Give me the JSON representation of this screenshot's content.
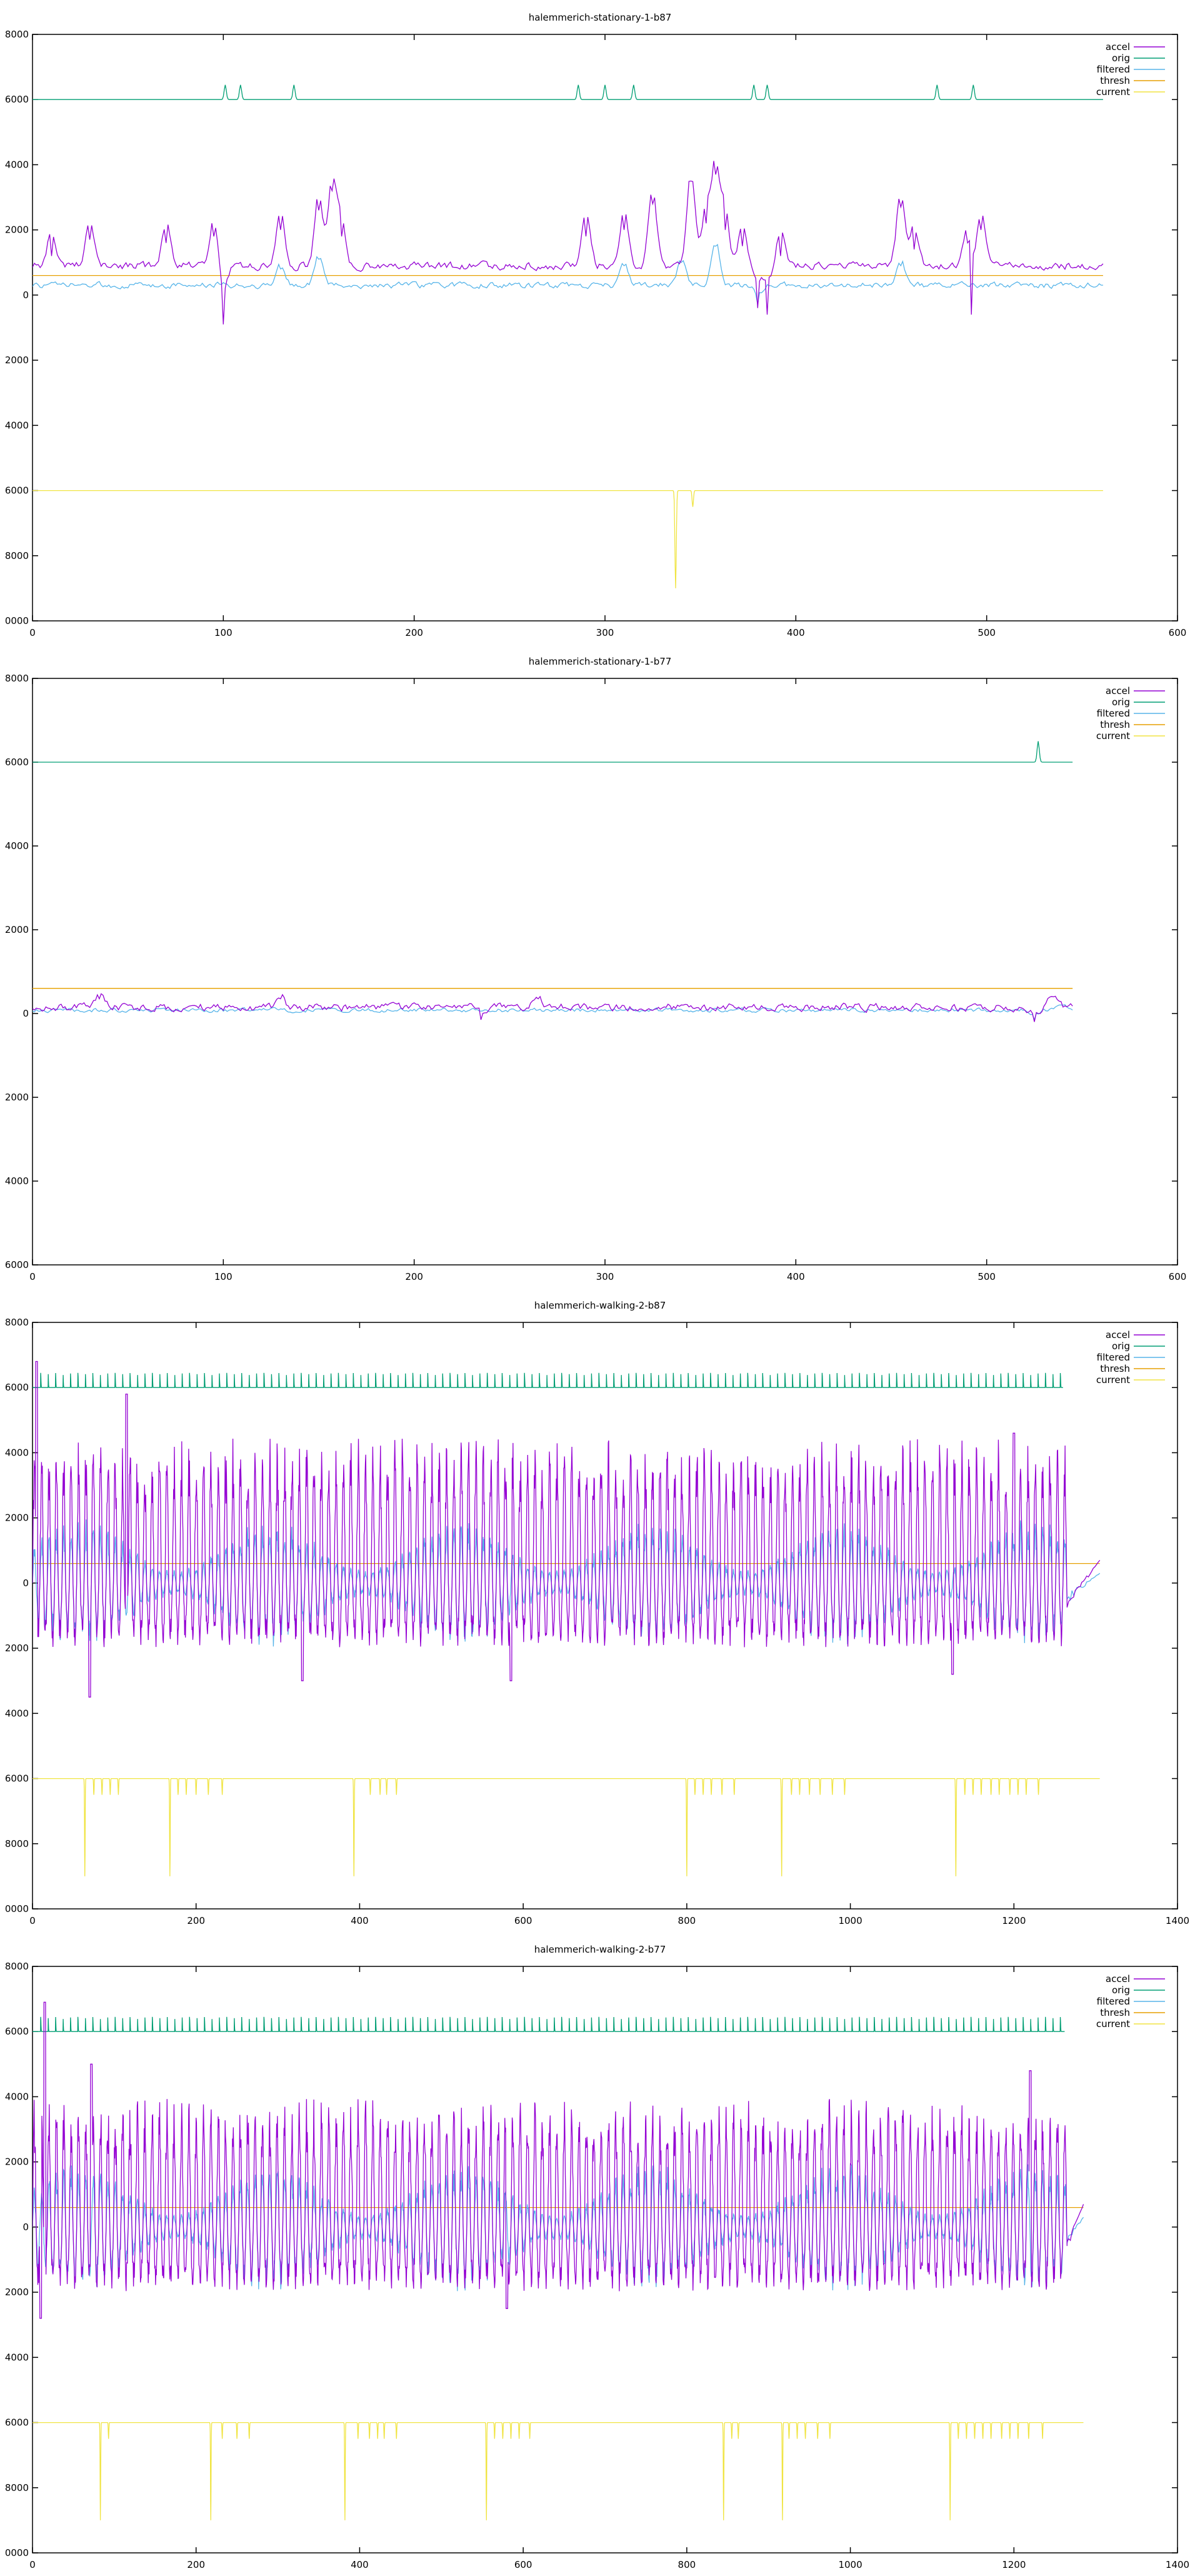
{
  "colors": {
    "accel": "#9400d3",
    "orig": "#009e73",
    "filtered": "#56b4e9",
    "thresh": "#e69f00",
    "current": "#f0e442"
  },
  "chart_data": [
    {
      "type": "line",
      "title": "halemmerich-stationary-1-b87",
      "xlim": [
        0,
        600
      ],
      "ylim": [
        -10000,
        8000
      ],
      "xticks": [
        0,
        100,
        200,
        300,
        400,
        500,
        600
      ],
      "yticks": [
        -10000,
        -8000,
        -6000,
        -4000,
        -2000,
        0,
        2000,
        4000,
        6000,
        8000
      ],
      "ytick_labels": [
        "0000",
        "8000",
        "6000",
        "4000",
        "2000",
        "0",
        "2000",
        "4000",
        "6000",
        "8000"
      ],
      "grid": false,
      "legend_position": "top-right",
      "series": [
        {
          "name": "accel",
          "color": "#9400d3",
          "base": 900,
          "amp": 200,
          "x_end": 561,
          "peaks": [
            [
              10,
              1200
            ],
            [
              30,
              1700
            ],
            [
              70,
              1600
            ],
            [
              95,
              1800
            ],
            [
              100,
              -900
            ],
            [
              130,
              2000
            ],
            [
              150,
              2600
            ],
            [
              157,
              3200
            ],
            [
              162,
              1800
            ],
            [
              290,
              1800
            ],
            [
              310,
              2000
            ],
            [
              325,
              2800
            ],
            [
              345,
              3500
            ],
            [
              353,
              2200
            ],
            [
              358,
              3700
            ],
            [
              363,
              2000
            ],
            [
              372,
              1500
            ],
            [
              380,
              -400
            ],
            [
              385,
              -600
            ],
            [
              392,
              1200
            ],
            [
              455,
              2700
            ],
            [
              462,
              1400
            ],
            [
              490,
              1600
            ],
            [
              497,
              2000
            ],
            [
              492,
              -600
            ]
          ]
        },
        {
          "name": "orig",
          "color": "#009e73",
          "base": 6000,
          "amp": 0,
          "x_end": 561,
          "spikes": [
            [
              101,
              6450
            ],
            [
              109,
              6450
            ],
            [
              137,
              6450
            ],
            [
              286,
              6450
            ],
            [
              300,
              6450
            ],
            [
              315,
              6450
            ],
            [
              378,
              6450
            ],
            [
              385,
              6450
            ],
            [
              474,
              6450
            ],
            [
              493,
              6450
            ]
          ]
        },
        {
          "name": "filtered",
          "color": "#56b4e9",
          "base": 300,
          "amp": 150,
          "x_end": 561,
          "peaks": [
            [
              130,
              800
            ],
            [
              150,
              1100
            ],
            [
              310,
              900
            ],
            [
              340,
              1000
            ],
            [
              358,
              1500
            ],
            [
              380,
              -300
            ],
            [
              455,
              900
            ]
          ]
        },
        {
          "name": "thresh",
          "color": "#e69f00",
          "constant": 600,
          "x_end": 561
        },
        {
          "name": "current",
          "color": "#f0e442",
          "base": -6000,
          "x_end": 561,
          "dips": [
            [
              337,
              -9000
            ],
            [
              346,
              -6500
            ]
          ]
        }
      ]
    },
    {
      "type": "line",
      "title": "halemmerich-stationary-1-b77",
      "xlim": [
        0,
        600
      ],
      "ylim": [
        -6000,
        8000
      ],
      "xticks": [
        0,
        100,
        200,
        300,
        400,
        500,
        600
      ],
      "yticks": [
        -6000,
        -4000,
        -2000,
        0,
        2000,
        4000,
        6000,
        8000
      ],
      "ytick_labels": [
        "6000",
        "4000",
        "2000",
        "0",
        "2000",
        "4000",
        "6000",
        "8000"
      ],
      "grid": false,
      "legend_position": "top-right",
      "series": [
        {
          "name": "accel",
          "color": "#9400d3",
          "base": 150,
          "amp": 150,
          "x_end": 545,
          "peaks": [
            [
              35,
              350
            ],
            [
              130,
              350
            ],
            [
              235,
              -150
            ],
            [
              265,
              350
            ],
            [
              525,
              -200
            ],
            [
              535,
              400
            ]
          ]
        },
        {
          "name": "orig",
          "color": "#009e73",
          "base": 6000,
          "amp": 0,
          "x_end": 545,
          "spikes": [
            [
              527,
              6500
            ]
          ]
        },
        {
          "name": "filtered",
          "color": "#56b4e9",
          "base": 80,
          "amp": 80,
          "x_end": 545,
          "peaks": [
            [
              525,
              -150
            ],
            [
              540,
              200
            ]
          ]
        },
        {
          "name": "thresh",
          "color": "#e69f00",
          "constant": 600,
          "x_end": 545
        },
        {
          "name": "current",
          "color": "#f0e442",
          "constant": 600,
          "x_end": 545
        }
      ]
    },
    {
      "type": "line",
      "title": "halemmerich-walking-2-b87",
      "xlim": [
        0,
        1400
      ],
      "ylim": [
        -10000,
        8000
      ],
      "xticks": [
        0,
        200,
        400,
        600,
        800,
        1000,
        1200,
        1400
      ],
      "yticks": [
        -10000,
        -8000,
        -6000,
        -4000,
        -2000,
        0,
        2000,
        4000,
        6000,
        8000
      ],
      "ytick_labels": [
        "0000",
        "8000",
        "6000",
        "4000",
        "2000",
        "0",
        "2000",
        "4000",
        "6000",
        "8000"
      ],
      "grid": false,
      "legend_position": "top-right",
      "series": [
        {
          "name": "accel",
          "color": "#9400d3",
          "period": 9,
          "max_amp": 4500,
          "min_amp": -2000,
          "x_end": 1265,
          "tail_end": 1305,
          "peaks": [
            [
              5,
              6800
            ],
            [
              70,
              -3500
            ],
            [
              115,
              5800
            ],
            [
              330,
              -3000
            ],
            [
              585,
              -3000
            ],
            [
              1125,
              -2800
            ],
            [
              1200,
              4600
            ]
          ]
        },
        {
          "name": "orig",
          "color": "#009e73",
          "base": 6000,
          "spike": 6450,
          "period": 9.1,
          "x_start": 10,
          "x_end": 1260
        },
        {
          "name": "filtered",
          "color": "#56b4e9",
          "period": 9,
          "amp": 2000,
          "x_end": 1265,
          "tail_end": 1305
        },
        {
          "name": "thresh",
          "color": "#e69f00",
          "constant": 600,
          "x_end": 1305
        },
        {
          "name": "current",
          "color": "#f0e442",
          "base": -6000,
          "x_end": 1305,
          "dips": [
            [
              64,
              -9000
            ],
            [
              75,
              -6500
            ],
            [
              85,
              -6500
            ],
            [
              95,
              -6500
            ],
            [
              105,
              -6500
            ],
            [
              168,
              -9000
            ],
            [
              178,
              -6500
            ],
            [
              188,
              -6500
            ],
            [
              200,
              -6500
            ],
            [
              215,
              -6500
            ],
            [
              232,
              -6500
            ],
            [
              393,
              -9000
            ],
            [
              413,
              -6500
            ],
            [
              425,
              -6500
            ],
            [
              433,
              -6500
            ],
            [
              445,
              -6500
            ],
            [
              800,
              -9000
            ],
            [
              810,
              -6500
            ],
            [
              820,
              -6500
            ],
            [
              830,
              -6500
            ],
            [
              843,
              -6500
            ],
            [
              858,
              -6500
            ],
            [
              916,
              -9000
            ],
            [
              928,
              -6500
            ],
            [
              938,
              -6500
            ],
            [
              950,
              -6500
            ],
            [
              963,
              -6500
            ],
            [
              978,
              -6500
            ],
            [
              993,
              -6500
            ],
            [
              1129,
              -9000
            ],
            [
              1140,
              -6500
            ],
            [
              1150,
              -6500
            ],
            [
              1160,
              -6500
            ],
            [
              1172,
              -6500
            ],
            [
              1182,
              -6500
            ],
            [
              1195,
              -6500
            ],
            [
              1205,
              -6500
            ],
            [
              1215,
              -6500
            ],
            [
              1230,
              -6500
            ]
          ]
        }
      ]
    },
    {
      "type": "line",
      "title": "halemmerich-walking-2-b77",
      "xlim": [
        0,
        1400
      ],
      "ylim": [
        -10000,
        8000
      ],
      "xticks": [
        0,
        200,
        400,
        600,
        800,
        1000,
        1200,
        1400
      ],
      "yticks": [
        -10000,
        -8000,
        -6000,
        -4000,
        -2000,
        0,
        2000,
        4000,
        6000,
        8000
      ],
      "ytick_labels": [
        "0000",
        "8000",
        "6000",
        "4000",
        "2000",
        "0",
        "2000",
        "4000",
        "6000",
        "8000"
      ],
      "grid": false,
      "legend_position": "top-right",
      "series": [
        {
          "name": "accel",
          "color": "#9400d3",
          "period": 9,
          "max_amp": 4000,
          "min_amp": -2000,
          "x_end": 1265,
          "tail_end": 1285,
          "peaks": [
            [
              15,
              6900
            ],
            [
              10,
              -2800
            ],
            [
              72,
              5000
            ],
            [
              580,
              -2500
            ],
            [
              1220,
              4800
            ]
          ]
        },
        {
          "name": "orig",
          "color": "#009e73",
          "base": 6000,
          "spike": 6450,
          "period": 9.1,
          "x_start": 10,
          "x_end": 1262
        },
        {
          "name": "filtered",
          "color": "#56b4e9",
          "period": 9,
          "amp": 2000,
          "x_end": 1265,
          "tail_end": 1285
        },
        {
          "name": "thresh",
          "color": "#e69f00",
          "constant": 600,
          "x_end": 1285
        },
        {
          "name": "current",
          "color": "#f0e442",
          "base": -6000,
          "x_end": 1285,
          "dips": [
            [
              83,
              -9000
            ],
            [
              93,
              -6500
            ],
            [
              218,
              -9000
            ],
            [
              232,
              -6500
            ],
            [
              250,
              -6500
            ],
            [
              265,
              -6500
            ],
            [
              382,
              -9000
            ],
            [
              398,
              -6500
            ],
            [
              412,
              -6500
            ],
            [
              422,
              -6500
            ],
            [
              430,
              -6500
            ],
            [
              445,
              -6500
            ],
            [
              555,
              -9000
            ],
            [
              565,
              -6500
            ],
            [
              575,
              -6500
            ],
            [
              585,
              -6500
            ],
            [
              595,
              -6500
            ],
            [
              608,
              -6500
            ],
            [
              845,
              -9000
            ],
            [
              855,
              -6500
            ],
            [
              863,
              -6500
            ],
            [
              917,
              -9000
            ],
            [
              925,
              -6500
            ],
            [
              935,
              -6500
            ],
            [
              945,
              -6500
            ],
            [
              960,
              -6500
            ],
            [
              975,
              -6500
            ],
            [
              1122,
              -9000
            ],
            [
              1132,
              -6500
            ],
            [
              1142,
              -6500
            ],
            [
              1152,
              -6500
            ],
            [
              1162,
              -6500
            ],
            [
              1172,
              -6500
            ],
            [
              1185,
              -6500
            ],
            [
              1195,
              -6500
            ],
            [
              1205,
              -6500
            ],
            [
              1218,
              -6500
            ],
            [
              1235,
              -6500
            ]
          ]
        }
      ]
    }
  ]
}
